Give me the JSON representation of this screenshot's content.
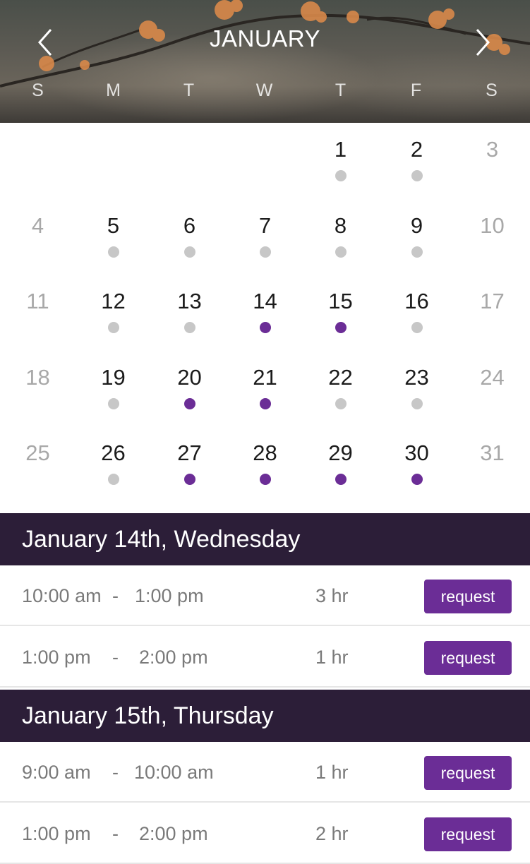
{
  "header": {
    "month": "JANUARY",
    "prev_icon": "chevron-left-icon",
    "next_icon": "chevron-right-icon",
    "weekdays": [
      "S",
      "M",
      "T",
      "W",
      "T",
      "F",
      "S"
    ]
  },
  "colors": {
    "accent": "#6b2d96",
    "dot_unavailable": "#c7c7c7",
    "date_header_bg": "#2c1e38"
  },
  "calendar": {
    "weeks": [
      [
        null,
        null,
        null,
        null,
        {
          "day": "1",
          "dot": "grey"
        },
        {
          "day": "2",
          "dot": "grey"
        },
        {
          "day": "3",
          "dot": null
        }
      ],
      [
        {
          "day": "4",
          "dot": null
        },
        {
          "day": "5",
          "dot": "grey"
        },
        {
          "day": "6",
          "dot": "grey"
        },
        {
          "day": "7",
          "dot": "grey"
        },
        {
          "day": "8",
          "dot": "grey"
        },
        {
          "day": "9",
          "dot": "grey"
        },
        {
          "day": "10",
          "dot": null
        }
      ],
      [
        {
          "day": "11",
          "dot": null
        },
        {
          "day": "12",
          "dot": "grey"
        },
        {
          "day": "13",
          "dot": "grey"
        },
        {
          "day": "14",
          "dot": "purple"
        },
        {
          "day": "15",
          "dot": "purple"
        },
        {
          "day": "16",
          "dot": "grey"
        },
        {
          "day": "17",
          "dot": null
        }
      ],
      [
        {
          "day": "18",
          "dot": null
        },
        {
          "day": "19",
          "dot": "grey"
        },
        {
          "day": "20",
          "dot": "purple"
        },
        {
          "day": "21",
          "dot": "purple"
        },
        {
          "day": "22",
          "dot": "grey"
        },
        {
          "day": "23",
          "dot": "grey"
        },
        {
          "day": "24",
          "dot": null
        }
      ],
      [
        {
          "day": "25",
          "dot": null
        },
        {
          "day": "26",
          "dot": "grey"
        },
        {
          "day": "27",
          "dot": "purple"
        },
        {
          "day": "28",
          "dot": "purple"
        },
        {
          "day": "29",
          "dot": "purple"
        },
        {
          "day": "30",
          "dot": "purple"
        },
        {
          "day": "31",
          "dot": null
        }
      ]
    ]
  },
  "schedule": [
    {
      "date_label": "January 14th, Wednesday",
      "slots": [
        {
          "start": "10:00 am",
          "sep": "-",
          "end": "1:00 pm",
          "duration": "3 hr",
          "button": "request"
        },
        {
          "start": "1:00 pm",
          "sep": "-",
          "end": "2:00 pm",
          "duration": "1 hr",
          "button": "request"
        }
      ]
    },
    {
      "date_label": "January 15th, Thursday",
      "slots": [
        {
          "start": "9:00 am",
          "sep": "-",
          "end": "10:00 am",
          "duration": "1 hr",
          "button": "request"
        },
        {
          "start": "1:00 pm",
          "sep": "-",
          "end": "2:00 pm",
          "duration": "2 hr",
          "button": "request"
        }
      ]
    }
  ]
}
